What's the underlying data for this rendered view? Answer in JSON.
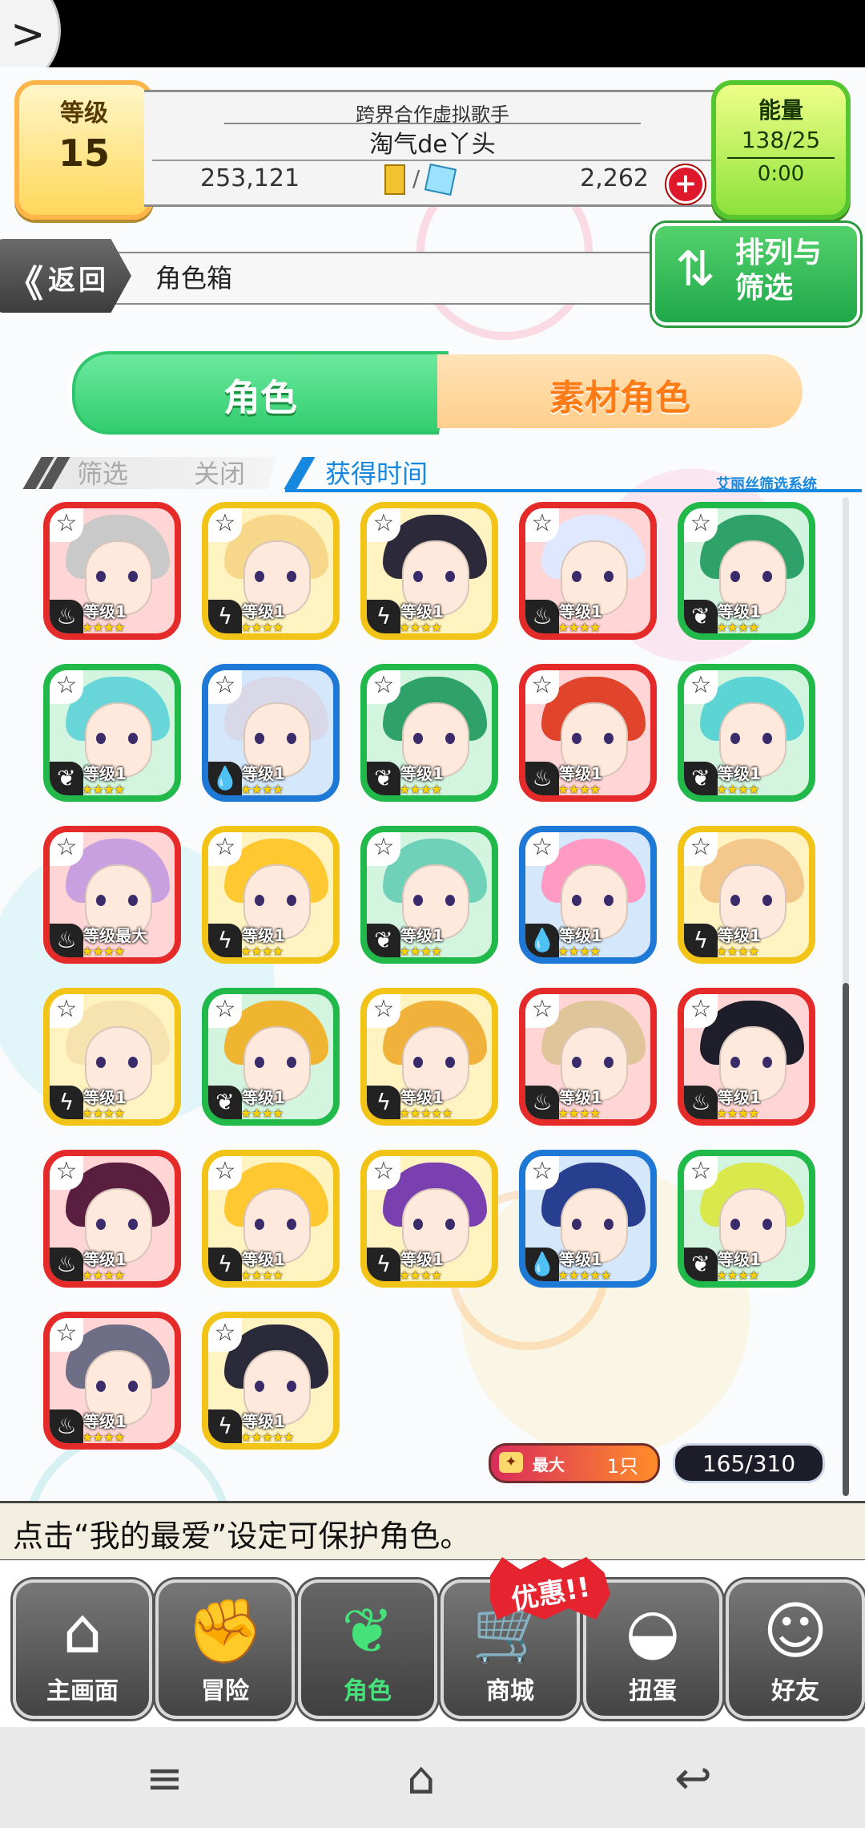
{
  "header": {
    "level_label": "等级",
    "level_value": "15",
    "title": "跨界合作虚拟歌手",
    "username": "淘气de丫头",
    "coins": "253,121",
    "gems": "2,262",
    "currency_separator": "/",
    "energy_label": "能量",
    "energy_value": "138/25",
    "energy_timer": "0:00"
  },
  "nav": {
    "back_label": "返回",
    "back_chevron": "《",
    "section_title": "角色箱",
    "sort_filter_label": "排列与筛选"
  },
  "tabs": [
    {
      "label": "角色",
      "active": true
    },
    {
      "label": "素材角色",
      "active": false
    }
  ],
  "filter": {
    "label": "筛选",
    "value": "关闭",
    "sort_by": "获得时间",
    "system_label": "艾丽丝筛选系统"
  },
  "cards": [
    {
      "element": "fire",
      "color": "red",
      "level_text": "等级1",
      "stars": 4
    },
    {
      "element": "bolt",
      "color": "yellow",
      "level_text": "等级1",
      "stars": 4
    },
    {
      "element": "bolt",
      "color": "yellow",
      "level_text": "等级1",
      "stars": 4
    },
    {
      "element": "fire",
      "color": "red",
      "level_text": "等级1",
      "stars": 4
    },
    {
      "element": "leaf",
      "color": "green",
      "level_text": "等级1",
      "stars": 4
    },
    {
      "element": "leaf",
      "color": "green",
      "level_text": "等级1",
      "stars": 4
    },
    {
      "element": "water",
      "color": "blue",
      "level_text": "等级1",
      "stars": 4
    },
    {
      "element": "leaf",
      "color": "green",
      "level_text": "等级1",
      "stars": 4
    },
    {
      "element": "fire",
      "color": "red",
      "level_text": "等级1",
      "stars": 4
    },
    {
      "element": "leaf",
      "color": "green",
      "level_text": "等级1",
      "stars": 4
    },
    {
      "element": "fire",
      "color": "red",
      "level_text": "等级最大",
      "stars": 4
    },
    {
      "element": "bolt",
      "color": "yellow",
      "level_text": "等级1",
      "stars": 4
    },
    {
      "element": "leaf",
      "color": "green",
      "level_text": "等级1",
      "stars": 4
    },
    {
      "element": "water",
      "color": "blue",
      "level_text": "等级1",
      "stars": 4
    },
    {
      "element": "bolt",
      "color": "yellow",
      "level_text": "等级1",
      "stars": 4
    },
    {
      "element": "bolt",
      "color": "yellow",
      "level_text": "等级1",
      "stars": 4
    },
    {
      "element": "leaf",
      "color": "green",
      "level_text": "等级1",
      "stars": 4
    },
    {
      "element": "bolt",
      "color": "yellow",
      "level_text": "等级1",
      "stars": 5
    },
    {
      "element": "fire",
      "color": "red",
      "level_text": "等级1",
      "stars": 4
    },
    {
      "element": "fire",
      "color": "red",
      "level_text": "等级1",
      "stars": 4
    },
    {
      "element": "fire",
      "color": "red",
      "level_text": "等级1",
      "stars": 4
    },
    {
      "element": "bolt",
      "color": "yellow",
      "level_text": "等级1",
      "stars": 4
    },
    {
      "element": "bolt",
      "color": "yellow",
      "level_text": "等级1",
      "stars": 4
    },
    {
      "element": "water",
      "color": "blue",
      "level_text": "等级1",
      "stars": 5
    },
    {
      "element": "leaf",
      "color": "green",
      "level_text": "等级1",
      "stars": 4
    },
    {
      "element": "fire",
      "color": "red",
      "level_text": "等级1",
      "stars": 4
    },
    {
      "element": "bolt",
      "color": "yellow",
      "level_text": "等级1",
      "stars": 5
    }
  ],
  "footer_status": {
    "max_label": "最大",
    "max_value": "1只",
    "count": "165/310"
  },
  "tip": "点击“我的最爱”设定可保护角色。",
  "bottom_nav": [
    {
      "label": "主画面",
      "icon": "home-icon",
      "glyph": "⌂",
      "active": false
    },
    {
      "label": "冒险",
      "icon": "handshake-icon",
      "glyph": "✊",
      "active": false
    },
    {
      "label": "角色",
      "icon": "rabbit-icon",
      "glyph": "❦",
      "active": true
    },
    {
      "label": "商城",
      "icon": "cart-icon",
      "glyph": "🛒",
      "active": false
    },
    {
      "label": "扭蛋",
      "icon": "egg-icon",
      "glyph": "◒",
      "active": false
    },
    {
      "label": "好友",
      "icon": "friends-icon",
      "glyph": "☺",
      "active": false
    }
  ],
  "promo_label": "优惠!!",
  "colors": {
    "red": "#e52a2a",
    "yellow": "#f3c418",
    "green": "#20b94a",
    "blue": "#1d78d6",
    "active_green": "#45e27a"
  },
  "element_glyphs": {
    "fire": "♨",
    "bolt": "ϟ",
    "leaf": "❦",
    "water": "💧"
  }
}
